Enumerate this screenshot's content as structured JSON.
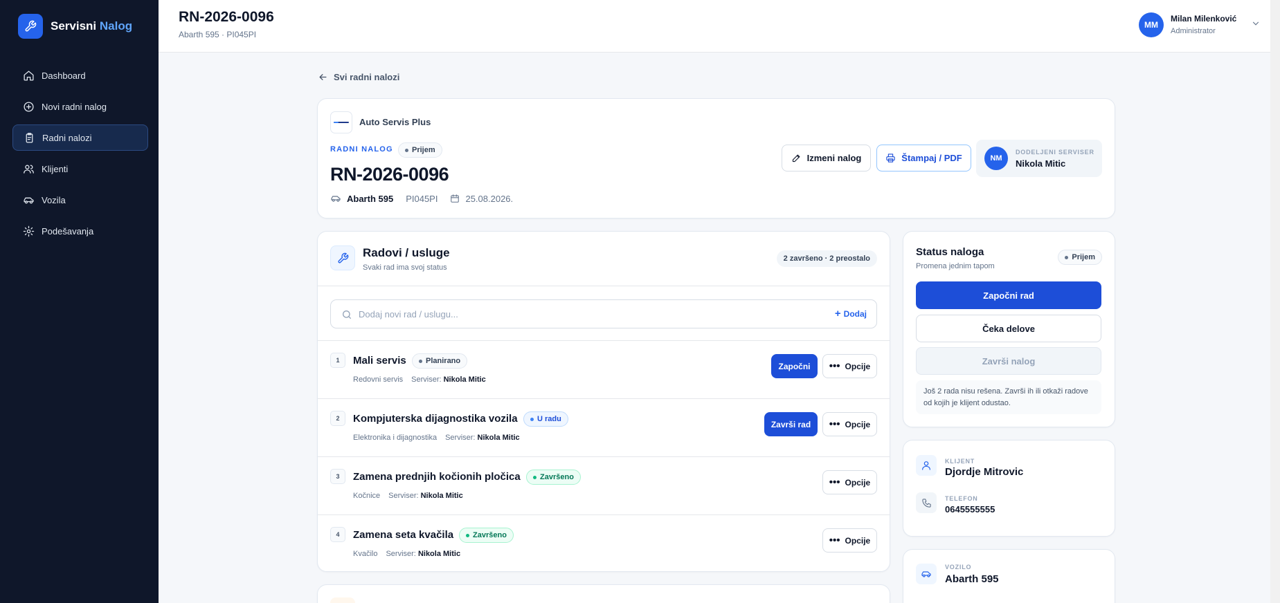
{
  "brand": {
    "name": "Servisni",
    "accent": "Nalog"
  },
  "nav": [
    {
      "label": "Dashboard",
      "icon": "home-icon"
    },
    {
      "label": "Novi radni nalog",
      "icon": "plus-circle-icon"
    },
    {
      "label": "Radni nalozi",
      "icon": "clipboard-icon",
      "active": true
    },
    {
      "label": "Klijenti",
      "icon": "users-icon"
    },
    {
      "label": "Vozila",
      "icon": "car-icon"
    },
    {
      "label": "Podešavanja",
      "icon": "gear-icon"
    }
  ],
  "topbar": {
    "title": "RN-2026-0096",
    "subtitle": "Abarth 595 · PI045PI",
    "user": {
      "initials": "MM",
      "name": "Milan Milenković",
      "role": "Administrator"
    }
  },
  "back_link": "Svi radni nalozi",
  "order": {
    "shop_name": "Auto Servis Plus",
    "label": "RADNI NALOG",
    "status": "Prijem",
    "number": "RN-2026-0096",
    "vehicle": "Abarth 595",
    "plate": "PI045PI",
    "date": "25.08.2026.",
    "edit_label": "Izmeni nalog",
    "print_label": "Štampaj / PDF",
    "assigned": {
      "initials": "NM",
      "label": "DODELJENI SERVISER",
      "name": "Nikola Mitic"
    }
  },
  "works": {
    "title": "Radovi / usluge",
    "subtitle": "Svaki rad ima svoj status",
    "count": "2 završeno · 2 preostalo",
    "search_placeholder": "Dodaj novi rad / uslugu...",
    "add_label": "Dodaj",
    "serviser_label": "Serviser:",
    "options_label": "Opcije",
    "items": [
      {
        "num": "1",
        "name": "Mali servis",
        "status": "Planirano",
        "category": "Redovni servis",
        "serviser": "Nikola Mitic",
        "action": "Započni"
      },
      {
        "num": "2",
        "name": "Kompjuterska dijagnostika vozila",
        "status": "U radu",
        "category": "Elektronika i dijagnostika",
        "serviser": "Nikola Mitic",
        "action": "Završi rad"
      },
      {
        "num": "3",
        "name": "Zamena prednjih kočionih pločica",
        "status": "Završeno",
        "category": "Kočnice",
        "serviser": "Nikola Mitic",
        "action": ""
      },
      {
        "num": "4",
        "name": "Zamena seta kvačila",
        "status": "Završeno",
        "category": "Kvačilo",
        "serviser": "Nikola Mitic",
        "action": ""
      }
    ]
  },
  "status_panel": {
    "title": "Status naloga",
    "subtitle": "Promena jednim tapom",
    "status": "Prijem",
    "start_label": "Započni rad",
    "wait_label": "Čeka delove",
    "finish_label": "Završi nalog",
    "note": "Još 2 rada nisu rešena. Završi ih ili otkaži radove od kojih je klijent odustao."
  },
  "client": {
    "client_label": "KLIJENT",
    "client_name": "Djordje Mitrovic",
    "phone_label": "TELEFON",
    "phone": "0645555555"
  },
  "vehicle_card": {
    "label": "VOZILO",
    "name": "Abarth 595"
  },
  "colors": {
    "sidebar": "#0f172a",
    "primary": "#1d4ed8",
    "accent": "#60a5fa"
  }
}
